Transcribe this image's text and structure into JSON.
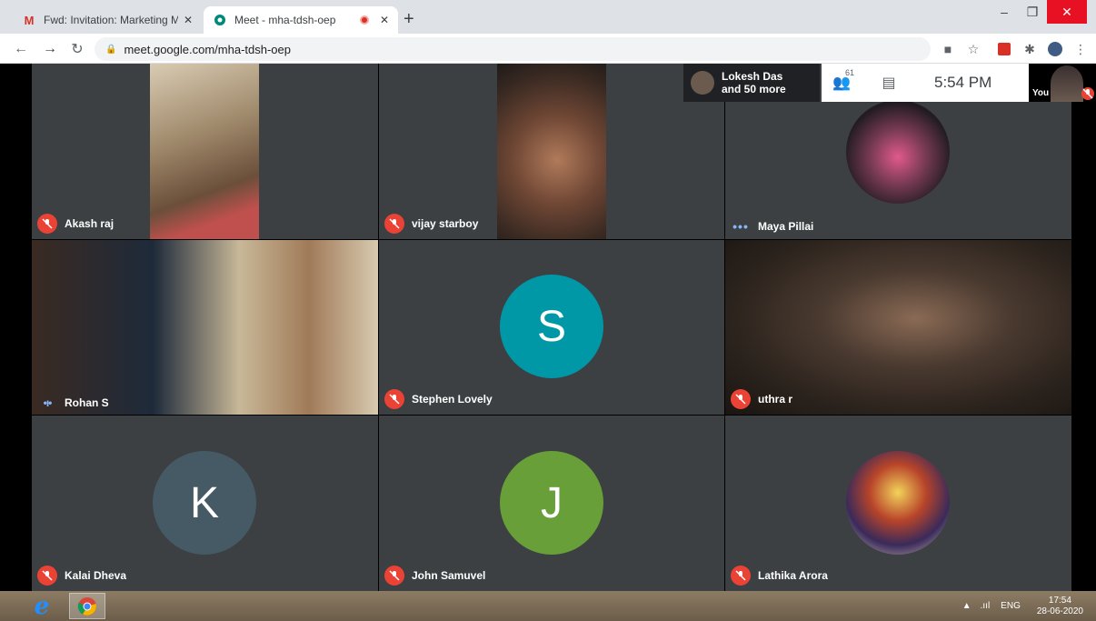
{
  "browser": {
    "tabs": [
      {
        "title": "Fwd: Invitation: Marketing Mana",
        "icon": "gmail-icon",
        "active": false
      },
      {
        "title": "Meet - mha-tdsh-oep",
        "icon": "meet-icon",
        "active": true,
        "recording": true
      }
    ],
    "new_tab": "+",
    "url": "meet.google.com/mha-tdsh-oep",
    "window_controls": {
      "minimize": "–",
      "maximize": "❐",
      "close": "✕"
    }
  },
  "meeting": {
    "info": {
      "presenter": "Lokesh Das",
      "others": "and 50 more",
      "participant_count": "61",
      "time": "5:54 PM"
    },
    "self_label": "You",
    "participants": [
      {
        "name": "Akash raj",
        "status": "muted"
      },
      {
        "name": "vijay starboy",
        "status": "muted"
      },
      {
        "name": "Maya Pillai",
        "status": "dots"
      },
      {
        "name": "Rohan S",
        "status": "speaking"
      },
      {
        "name": "Stephen Lovely",
        "status": "muted",
        "initial": "S",
        "avatar_color": "#0097a7"
      },
      {
        "name": "uthra r",
        "status": "muted"
      },
      {
        "name": "Kalai Dheva",
        "status": "muted",
        "initial": "K",
        "avatar_color": "#455a64"
      },
      {
        "name": "John Samuvel",
        "status": "muted",
        "initial": "J",
        "avatar_color": "#689f38"
      },
      {
        "name": "Lathika Arora",
        "status": "muted"
      }
    ]
  },
  "taskbar": {
    "language": "ENG",
    "time": "17:54",
    "date": "28-06-2020"
  }
}
